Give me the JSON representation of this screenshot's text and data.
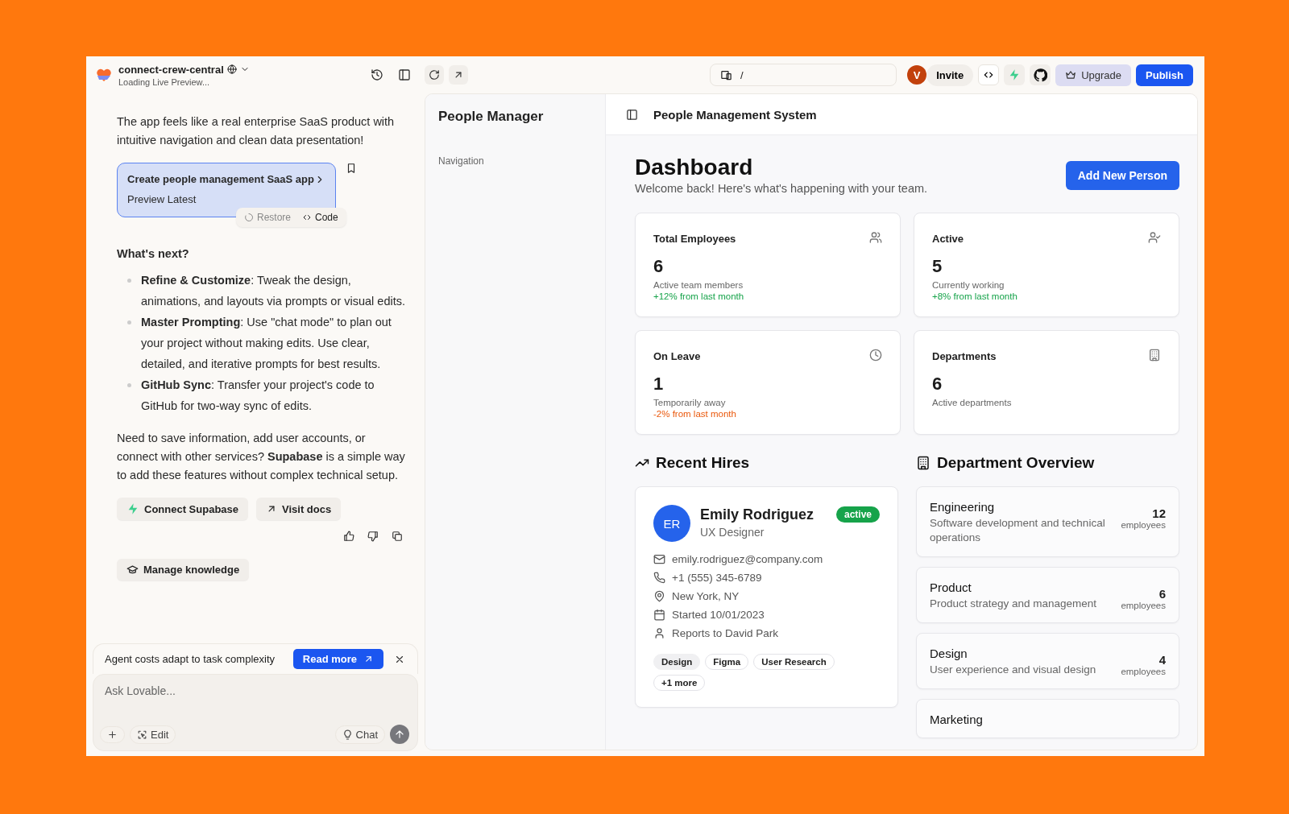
{
  "project": {
    "name": "connect-crew-central",
    "status": "Loading Live Preview..."
  },
  "topbar": {
    "url": "/",
    "avatar": "V",
    "invite": "Invite",
    "upgrade": "Upgrade",
    "publish": "Publish"
  },
  "chat": {
    "intro": "The app feels like a real enterprise SaaS product with intuitive navigation and clean data presentation!",
    "version": {
      "title": "Create people management SaaS app",
      "subtitle": "Preview Latest",
      "restore": "Restore",
      "code": "Code"
    },
    "next_heading": "What's next?",
    "tips": [
      {
        "text": "**Refine & Customize**: Tweak the design, animations, and layouts via prompts or visual edits."
      },
      {
        "text": "**Master Prompting**: Use \"chat mode\" to plan out your project without making edits. Use clear, detailed, and iterative prompts for best results."
      },
      {
        "text": "**GitHub Sync**: Transfer your project's code to GitHub for two-way sync of edits."
      }
    ],
    "note": "Need to save information, add user accounts, or connect with other services? **Supabase** is a simple way to add these features without complex technical setup.",
    "actions": [
      {
        "kind": "bolt",
        "label": "Connect Supabase"
      },
      {
        "kind": "arrow",
        "label": "Visit docs"
      },
      {
        "kind": "cap",
        "label": "Manage knowledge"
      }
    ],
    "notice": {
      "text": "Agent costs adapt to task complexity",
      "button": "Read more"
    },
    "composer": {
      "placeholder": "Ask Lovable...",
      "edit": "Edit",
      "chat": "Chat"
    }
  },
  "preview": {
    "sidebar": {
      "title": "People Manager",
      "section": "Navigation"
    },
    "header_title": "People Management System",
    "dashboard": {
      "title": "Dashboard",
      "subtitle": "Welcome back! Here's what's happening with your team.",
      "add_button": "Add New Person",
      "stats": [
        {
          "label": "Total Employees",
          "value": "6",
          "note": "Active team members",
          "change": "+12% from last month",
          "positive": true,
          "kind": "users"
        },
        {
          "label": "Active",
          "value": "5",
          "note": "Currently working",
          "change": "+8% from last month",
          "positive": true,
          "kind": "user-check"
        },
        {
          "label": "On Leave",
          "value": "1",
          "note": "Temporarily away",
          "change": "-2% from last month",
          "positive": false,
          "kind": "clock"
        },
        {
          "label": "Departments",
          "value": "6",
          "note": "Active departments",
          "kind": "building"
        }
      ],
      "recent_title": "Recent Hires",
      "hire": {
        "initials": "ER",
        "name": "Emily Rodriguez",
        "role": "UX Designer",
        "status": "active",
        "details": [
          {
            "kind": "email",
            "text": "emily.rodriguez@company.com"
          },
          {
            "kind": "phone",
            "text": "+1 (555) 345-6789"
          },
          {
            "kind": "location",
            "text": "New York, NY"
          },
          {
            "kind": "calendar",
            "text": "Started 10/01/2023"
          },
          {
            "kind": "person",
            "text": "Reports to David Park"
          }
        ],
        "tags": [
          {
            "label": "Design",
            "selected": true
          },
          {
            "label": "Figma",
            "selected": false
          },
          {
            "label": "User Research",
            "selected": false
          },
          {
            "label": "+1 more",
            "selected": false
          }
        ]
      },
      "dept_title": "Department Overview",
      "departments": [
        {
          "name": "Engineering",
          "description": "Software development and technical operations",
          "count": "12",
          "unit": "employees"
        },
        {
          "name": "Product",
          "description": "Product strategy and management",
          "count": "6",
          "unit": "employees"
        },
        {
          "name": "Design",
          "description": "User experience and visual design",
          "count": "4",
          "unit": "employees"
        },
        {
          "name": "Marketing"
        }
      ]
    }
  }
}
